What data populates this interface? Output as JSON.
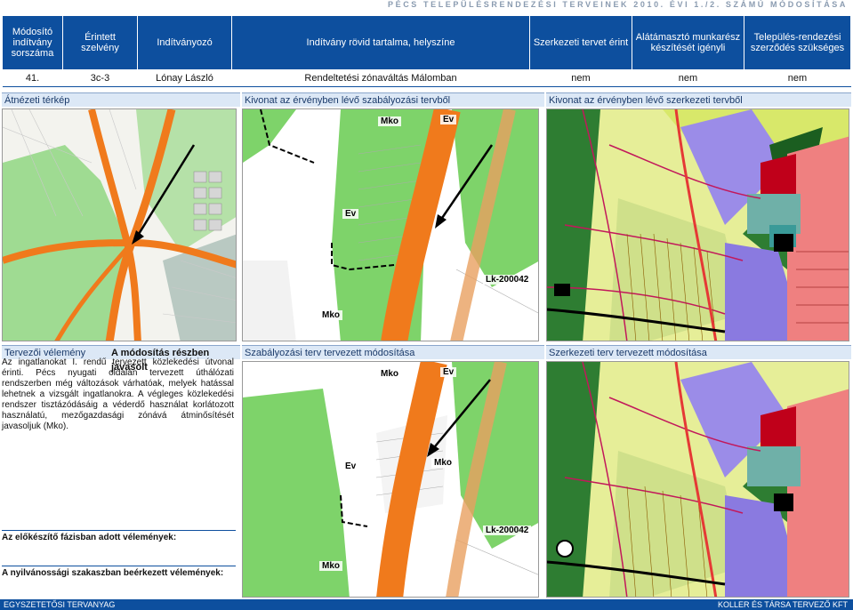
{
  "header_title": "PÉCS TELEPÜLÉSRENDEZÉSI TERVEINEK 2010. ÉVI 1./2. SZÁMÚ MÓDOSÍTÁSA",
  "table": {
    "columns": [
      "Módosító indítvány sorszáma",
      "Érintett szelvény",
      "Indítványozó",
      "Indítvány rövid tartalma, helyszíne",
      "Szerkezeti tervet érint",
      "Alátámasztó munkarész készítését igényli",
      "Település-rendezési szerződés szükséges"
    ],
    "row": [
      "41.",
      "3c-3",
      "Lónay László",
      "Rendeltetési zónaváltás Málomban",
      "nem",
      "nem",
      "nem"
    ]
  },
  "sections": {
    "overview": "Átnézeti térkép",
    "reg_extract": "Kivonat az érvényben lévő szabályozási tervből",
    "struct_extract": "Kivonat az érvényben lévő szerkezeti tervből",
    "designer_opinion": "Tervezői vélemény",
    "recommended": "A módosítás részben javasolt",
    "reg_proposed": "Szabályozási terv tervezett módosítása",
    "struct_proposed": "Szerkezeti terv tervezett módosítása",
    "prelim_opinions": "Az előkészítő fázisban adott vélemények:",
    "public_opinions": "A nyilvánossági szakaszban beérkezett vélemények:"
  },
  "opinion_text": "Az ingatlanokat I. rendű tervezett közlekedési útvonal érinti. Pécs nyugati oldalán tervezett úthálózati rendszerben még változások várhatóak, melyek hatással lehetnek a vizsgált ingatlanokra. A végleges közlekedési rendszer tisztázódásáig a véderdő használat korlátozott használatú, mezőgazdasági zónává átminősítését javasoljuk (Mko).",
  "map_labels": {
    "mko": "Mko",
    "ev": "Ev",
    "lk": "Lk-200042"
  },
  "footer": {
    "left": "EGYSZETETŐSI TERVANYAG",
    "right": "KOLLER ÉS TÁRSA TERVEZŐ KFT"
  },
  "colors": {
    "brand": "#0d4f9e",
    "road": "#f07a1c",
    "green": "#7ed36a",
    "forest": "#2e7d32"
  }
}
